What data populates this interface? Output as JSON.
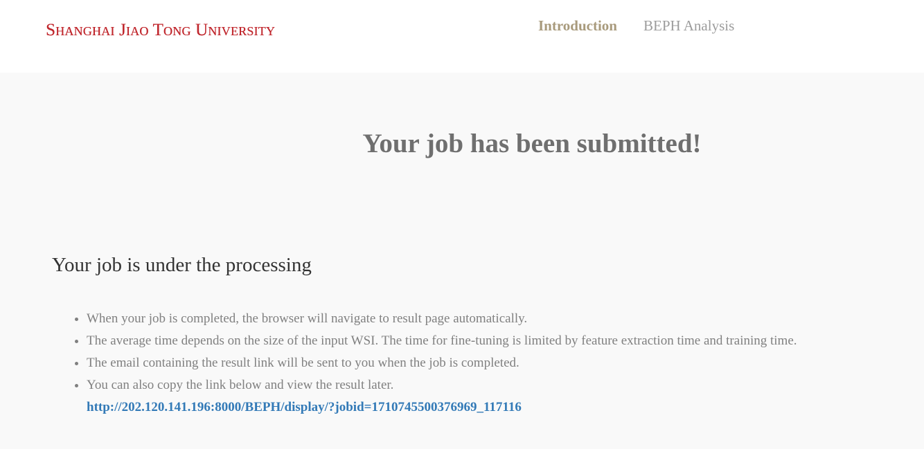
{
  "header": {
    "logo_text": "Shanghai Jiao Tong University",
    "nav": [
      {
        "label": "Introduction",
        "active": true
      },
      {
        "label": "BEPH Analysis",
        "active": false
      }
    ]
  },
  "main": {
    "title": "Your job has been submitted!",
    "section_title": "Your job is under the processing",
    "notes": [
      "When your job is completed, the browser will navigate to result page automatically.",
      "The average time depends on the size of the input WSI. The time for fine-tuning is limited by feature extraction time and training time.",
      "The email containing the result link will be sent to you when the job is completed.",
      "You can also copy the link below and view the result later."
    ],
    "result_link": "http://202.120.141.196:8000/BEPH/display/?jobid=1710745500376969_117116"
  },
  "colors": {
    "logo": "#c0272d",
    "nav_active": "#a89a7c",
    "nav_inactive": "#9c9c9c",
    "link": "#337ab7",
    "background": "#f9f9f9"
  }
}
